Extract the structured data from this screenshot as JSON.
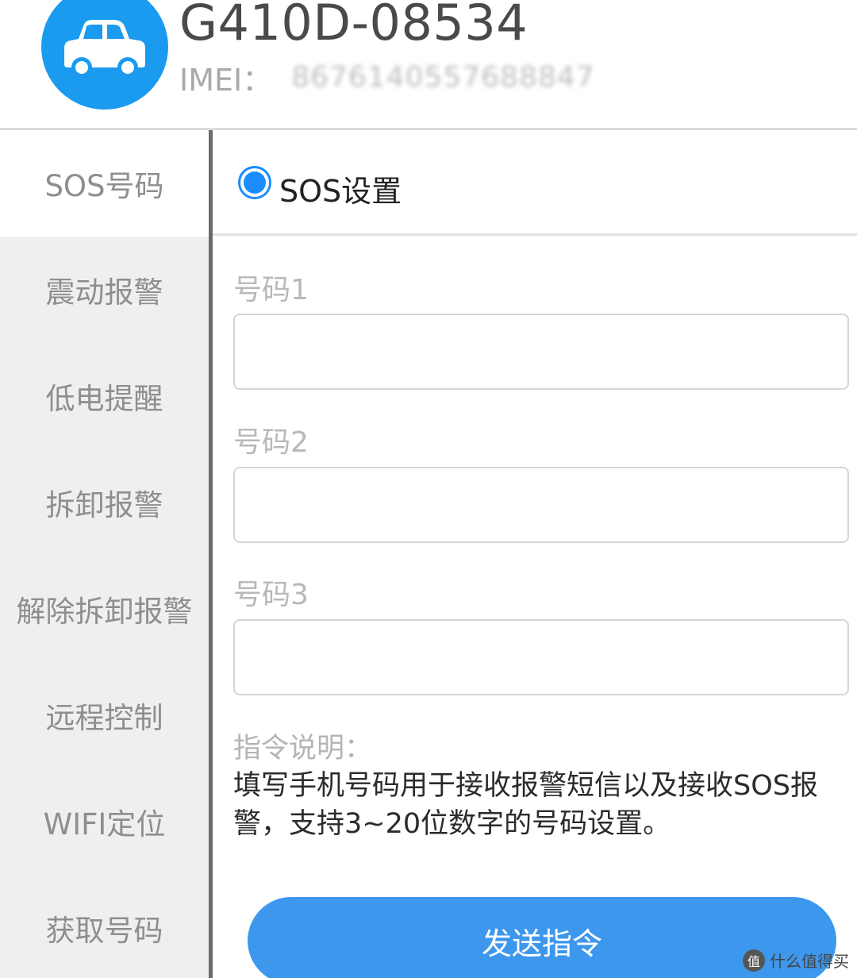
{
  "header": {
    "avatar_icon": "car-icon",
    "device_name": "G410D-08534",
    "imei_label": "IMEI：",
    "imei_value": "8676140557688847"
  },
  "sidebar": {
    "items": [
      {
        "label": "SOS号码",
        "active": true
      },
      {
        "label": "震动报警",
        "active": false
      },
      {
        "label": "低电提醒",
        "active": false
      },
      {
        "label": "拆卸报警",
        "active": false
      },
      {
        "label": "解除拆卸报警",
        "active": false
      },
      {
        "label": "远程控制",
        "active": false
      },
      {
        "label": "WIFI定位",
        "active": false
      },
      {
        "label": "获取号码",
        "active": false
      }
    ]
  },
  "main": {
    "section_title": "SOS设置",
    "fields": [
      {
        "label": "号码1",
        "value": "",
        "placeholder": ""
      },
      {
        "label": "号码2",
        "value": "",
        "placeholder": ""
      },
      {
        "label": "号码3",
        "value": "",
        "placeholder": ""
      }
    ],
    "description_label": "指令说明：",
    "description_text": "填写手机号码用于接收报警短信以及接收SOS报警，支持3~20位数字的号码设置。",
    "send_button_label": "发送指令"
  },
  "watermark": {
    "logo": "值",
    "text": "什么值得买"
  },
  "colors": {
    "accent": "#1a8cff",
    "avatar_bg": "#1a9bf0",
    "button_bg": "#3d97ed",
    "sidebar_bg": "#efefef"
  }
}
